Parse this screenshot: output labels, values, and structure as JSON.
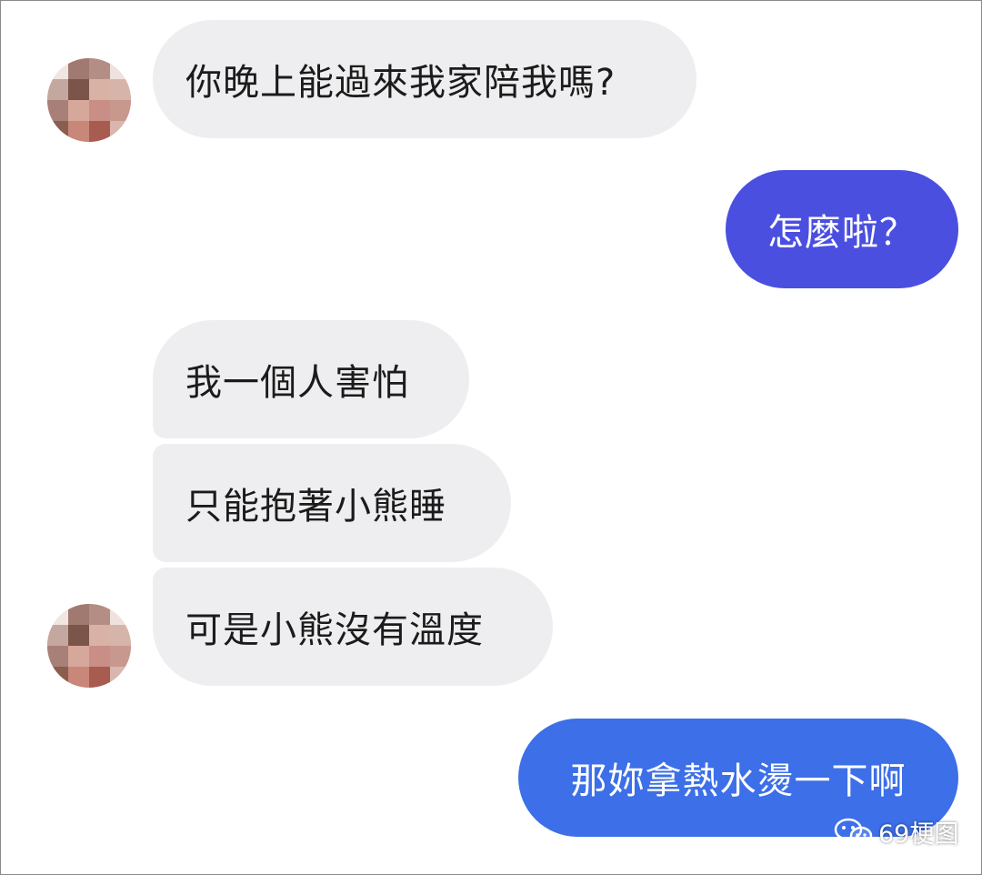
{
  "messages": [
    {
      "id": "m1",
      "sender": "contact",
      "text": "你晚上能過來我家陪我嗎?"
    },
    {
      "id": "m2",
      "sender": "me",
      "text": "怎麼啦？"
    },
    {
      "id": "m3",
      "sender": "contact",
      "text": "我一個人害怕"
    },
    {
      "id": "m4",
      "sender": "contact",
      "text": "只能抱著小熊睡"
    },
    {
      "id": "m5",
      "sender": "contact",
      "text": "可是小熊沒有溫度"
    },
    {
      "id": "m6",
      "sender": "me",
      "text": "那妳拿熱水燙一下啊"
    }
  ],
  "watermark": {
    "icon": "wechat-icon",
    "text": "69梗图"
  },
  "colors": {
    "incoming_bubble": "#eeeef0",
    "outgoing_bubble_1": "#4a4fe0",
    "outgoing_bubble_2": "#3c6fe8",
    "text_dark": "#1b1b1b",
    "text_light": "#ffffff"
  }
}
